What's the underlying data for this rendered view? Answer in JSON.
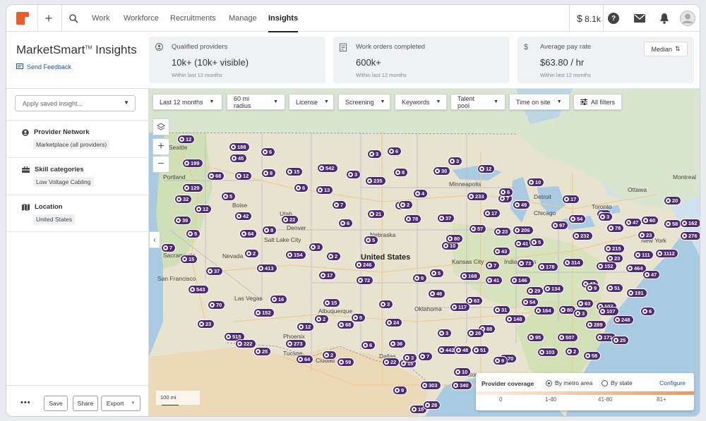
{
  "nav": {
    "tabs": [
      "Work",
      "Workforce",
      "Recruitments",
      "Manage",
      "Insights"
    ],
    "active_tab": "Insights",
    "balance": "8.1k"
  },
  "brand": {
    "name": "MarketSmart",
    "tm": "TM",
    "suffix": " Insights"
  },
  "feedback": "Send Feedback",
  "metrics": [
    {
      "label": "Qualified providers",
      "value": "10k+ (10k+ visible)",
      "sub": "Within last 12 months",
      "icon": "people-icon"
    },
    {
      "label": "Work orders completed",
      "value": "600k+",
      "sub": "Within last 12 months",
      "icon": "clipboard-icon"
    },
    {
      "label": "Average pay rate",
      "value": "$63.80 / hr",
      "sub": "Within last 12 months",
      "icon": "dollar-icon",
      "toggle": "Median"
    }
  ],
  "sidebar": {
    "saved_placeholder": "Apply saved insight...",
    "sections": [
      {
        "title": "Provider Network",
        "value": "Marketplace (all providers)"
      },
      {
        "title": "Skill categories",
        "value": "Low Voltage Cabling"
      },
      {
        "title": "Location",
        "value": "United States"
      }
    ],
    "footer": {
      "save": "Save",
      "share": "Share",
      "export": "Export"
    }
  },
  "filters": [
    "Last 12 months",
    "60 mi radius",
    "License",
    "Screening",
    "Keywords",
    "Talent pool",
    "Time on site",
    "All filters"
  ],
  "map": {
    "scale": "100 mi",
    "country_label": "United States",
    "cities": [
      "Seattle",
      "Portland",
      "Boise",
      "Sacramento",
      "San Francisco",
      "Las Vegas",
      "Salt Lake City",
      "Denver",
      "Albuquerque",
      "Phoenix",
      "Tucson",
      "Ciudad",
      "Dallas",
      "Houston",
      "Oklahoma",
      "Kansas City",
      "Minneapolis",
      "Chicago",
      "Detroit",
      "Toronto",
      "Ottawa",
      "Montreal",
      "New York",
      "Indianapolis",
      "Nevada",
      "Nebraska",
      "Utah"
    ],
    "pins": [
      {
        "v": "12"
      },
      {
        "v": "188"
      },
      {
        "v": "45"
      },
      {
        "v": "6"
      },
      {
        "v": "6"
      },
      {
        "v": "3"
      },
      {
        "v": "199"
      },
      {
        "v": "15"
      },
      {
        "v": "68"
      },
      {
        "v": "12"
      },
      {
        "v": "8"
      },
      {
        "v": "542"
      },
      {
        "v": "3"
      },
      {
        "v": "235"
      },
      {
        "v": "8"
      },
      {
        "v": "129"
      },
      {
        "v": "32"
      },
      {
        "v": "6"
      },
      {
        "v": "13"
      },
      {
        "v": "5"
      },
      {
        "v": "7"
      },
      {
        "v": "12"
      },
      {
        "v": "42"
      },
      {
        "v": "22"
      },
      {
        "v": "21"
      },
      {
        "v": "2"
      },
      {
        "v": "39"
      },
      {
        "v": "6"
      },
      {
        "v": "78"
      },
      {
        "v": "5"
      },
      {
        "v": "8"
      },
      {
        "v": "64"
      },
      {
        "v": "5"
      },
      {
        "v": "7"
      },
      {
        "v": "15"
      },
      {
        "v": "2"
      },
      {
        "v": "154"
      },
      {
        "v": "3"
      },
      {
        "v": "2"
      },
      {
        "v": "413"
      },
      {
        "v": "37"
      },
      {
        "v": "246"
      },
      {
        "v": "17"
      },
      {
        "v": "72"
      },
      {
        "v": "543"
      },
      {
        "v": "16"
      },
      {
        "v": "15"
      },
      {
        "v": "3"
      },
      {
        "v": "70"
      },
      {
        "v": "152"
      },
      {
        "v": "23"
      },
      {
        "v": "2"
      },
      {
        "v": "5"
      },
      {
        "v": "68"
      },
      {
        "v": "12"
      },
      {
        "v": "515"
      },
      {
        "v": "222"
      },
      {
        "v": "273"
      },
      {
        "v": "25"
      },
      {
        "v": "64"
      },
      {
        "v": "2"
      },
      {
        "v": "59"
      },
      {
        "v": "24"
      },
      {
        "v": "36"
      },
      {
        "v": "6"
      },
      {
        "v": "22"
      },
      {
        "v": "15"
      },
      {
        "v": "3"
      },
      {
        "v": "7"
      },
      {
        "v": "30"
      },
      {
        "v": "12"
      },
      {
        "v": "3"
      },
      {
        "v": "10"
      },
      {
        "v": "233"
      },
      {
        "v": "7"
      },
      {
        "v": "6"
      },
      {
        "v": "4"
      },
      {
        "v": "49"
      },
      {
        "v": "17"
      },
      {
        "v": "17"
      },
      {
        "v": "2"
      },
      {
        "v": "37"
      },
      {
        "v": "3"
      },
      {
        "v": "10"
      },
      {
        "v": "80"
      },
      {
        "v": "57"
      },
      {
        "v": "23"
      },
      {
        "v": "206"
      },
      {
        "v": "41"
      },
      {
        "v": "43"
      },
      {
        "v": "5"
      },
      {
        "v": "168"
      },
      {
        "v": "7"
      },
      {
        "v": "41"
      },
      {
        "v": "146"
      },
      {
        "v": "9"
      },
      {
        "v": "73"
      },
      {
        "v": "178"
      },
      {
        "v": "46"
      },
      {
        "v": "63"
      },
      {
        "v": "29"
      },
      {
        "v": "134"
      },
      {
        "v": "117"
      },
      {
        "v": "31"
      },
      {
        "v": "54"
      },
      {
        "v": "164"
      },
      {
        "v": "80"
      },
      {
        "v": "63"
      },
      {
        "v": "107"
      },
      {
        "v": "107"
      },
      {
        "v": "148"
      },
      {
        "v": "88"
      },
      {
        "v": "26"
      },
      {
        "v": "3"
      },
      {
        "v": "3"
      },
      {
        "v": "95"
      },
      {
        "v": "507"
      },
      {
        "v": "289"
      },
      {
        "v": "248"
      },
      {
        "v": "442"
      },
      {
        "v": "48"
      },
      {
        "v": "51"
      },
      {
        "v": "70"
      },
      {
        "v": "2"
      },
      {
        "v": "103"
      },
      {
        "v": "171"
      },
      {
        "v": "25"
      },
      {
        "v": "58"
      },
      {
        "v": "9"
      },
      {
        "v": "10"
      },
      {
        "v": "303"
      },
      {
        "v": "340"
      },
      {
        "v": "9"
      },
      {
        "v": "15"
      },
      {
        "v": "28"
      },
      {
        "v": "20"
      },
      {
        "v": "60"
      },
      {
        "v": "58"
      },
      {
        "v": "162"
      },
      {
        "v": "276"
      },
      {
        "v": "3"
      },
      {
        "v": "78"
      },
      {
        "v": "47"
      },
      {
        "v": "23"
      },
      {
        "v": "1112"
      },
      {
        "v": "111"
      },
      {
        "v": "464"
      },
      {
        "v": "47"
      },
      {
        "v": "23"
      },
      {
        "v": "152"
      },
      {
        "v": "215"
      },
      {
        "v": "314"
      },
      {
        "v": "47"
      },
      {
        "v": "9"
      },
      {
        "v": "51"
      },
      {
        "v": "191"
      },
      {
        "v": "6"
      },
      {
        "v": "232"
      },
      {
        "v": "5"
      },
      {
        "v": "54"
      },
      {
        "v": "97"
      }
    ]
  },
  "legend": {
    "title": "Provider coverage",
    "opt1": "By metro area",
    "opt2": "By state",
    "configure": "Configure",
    "ticks": [
      "0",
      "1-40",
      "41-80",
      "81+"
    ]
  },
  "colors": {
    "accent": "#f05a28",
    "pin": "#4e2a75",
    "link": "#1a4fb0"
  }
}
